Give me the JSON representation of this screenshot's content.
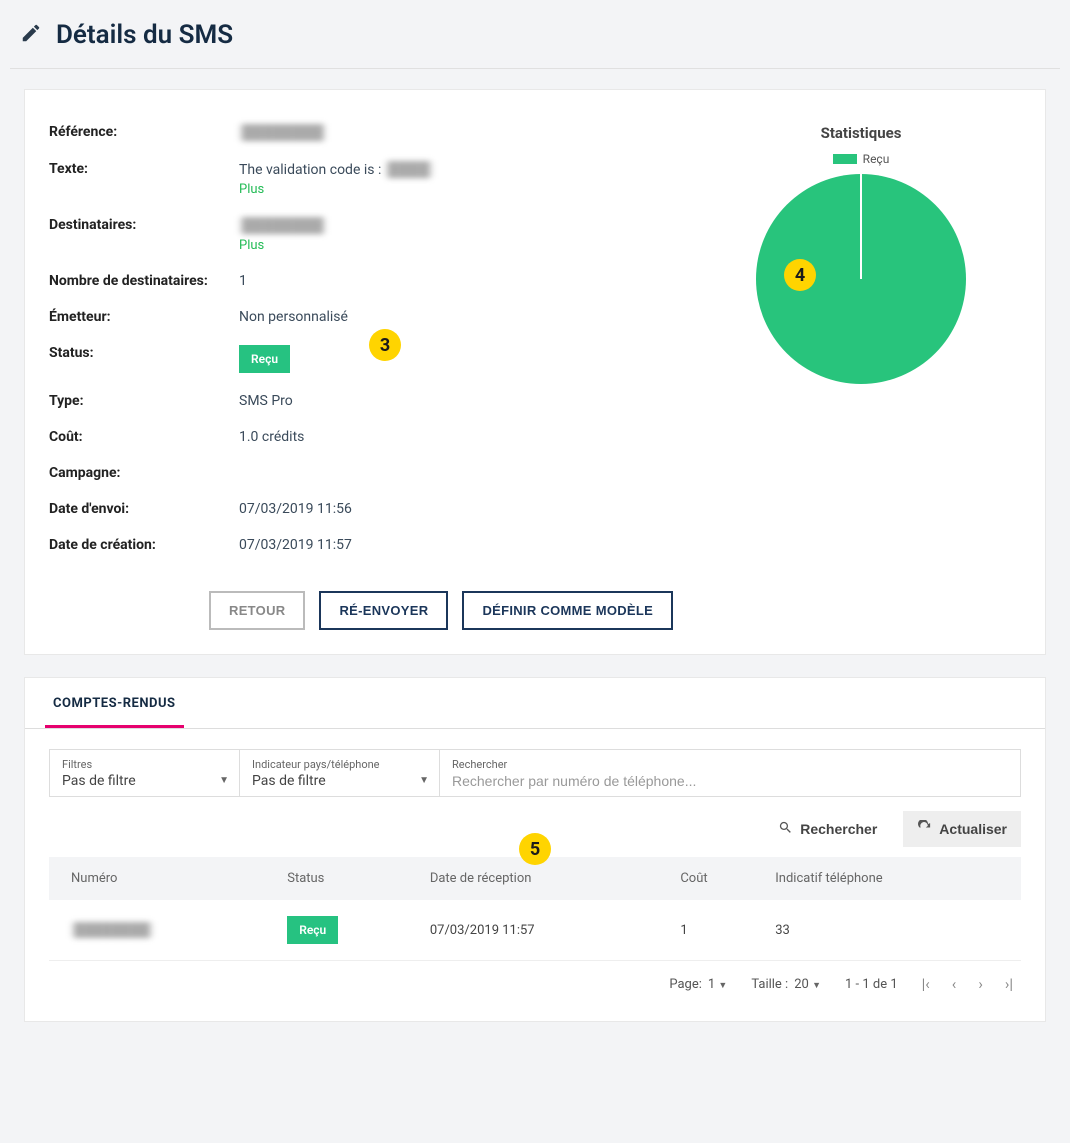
{
  "header": {
    "title": "Détails du SMS"
  },
  "details": {
    "reference_label": "Référence:",
    "reference_value": "████████",
    "text_label": "Texte:",
    "text_value_prefix": "The validation code is : ",
    "text_value_hidden": "████",
    "text_more": "Plus",
    "recipients_label": "Destinataires:",
    "recipients_value": "████████",
    "recipients_more": "Plus",
    "count_label": "Nombre de destinataires:",
    "count_value": "1",
    "sender_label": "Émetteur:",
    "sender_value": "Non personnalisé",
    "status_label": "Status:",
    "status_value": "Reçu",
    "type_label": "Type:",
    "type_value": "SMS Pro",
    "cost_label": "Coût:",
    "cost_value": "1.0 crédits",
    "campaign_label": "Campagne:",
    "campaign_value": "",
    "sent_label": "Date d'envoi:",
    "sent_value": "07/03/2019 11:56",
    "created_label": "Date de création:",
    "created_value": "07/03/2019 11:57"
  },
  "markers": {
    "m3": "3",
    "m4": "4",
    "m5": "5"
  },
  "stats": {
    "title": "Statistiques",
    "legend_label": "Reçu"
  },
  "chart_data": {
    "type": "pie",
    "title": "Statistiques",
    "series": [
      {
        "name": "Reçu",
        "value": 100,
        "color": "#28c47c"
      }
    ]
  },
  "actions": {
    "back": "RETOUR",
    "resend": "RÉ-ENVOYER",
    "save_template": "DÉFINIR COMME MODÈLE"
  },
  "reports": {
    "tab": "COMPTES-RENDUS",
    "filter_label": "Filtres",
    "filter_value": "Pas de filtre",
    "indicator_label": "Indicateur pays/téléphone",
    "indicator_value": "Pas de filtre",
    "search_label": "Rechercher",
    "search_placeholder": "Rechercher par numéro de téléphone...",
    "search_btn": "Rechercher",
    "refresh_btn": "Actualiser",
    "cols": {
      "number": "Numéro",
      "status": "Status",
      "received": "Date de réception",
      "cost": "Coût",
      "prefix": "Indicatif téléphone"
    },
    "rows": [
      {
        "number": "████████",
        "status": "Reçu",
        "received": "07/03/2019 11:57",
        "cost": "1",
        "prefix": "33"
      }
    ],
    "pager": {
      "page_label": "Page:",
      "page_value": "1",
      "size_label": "Taille :",
      "size_value": "20",
      "range": "1 - 1 de 1"
    }
  }
}
